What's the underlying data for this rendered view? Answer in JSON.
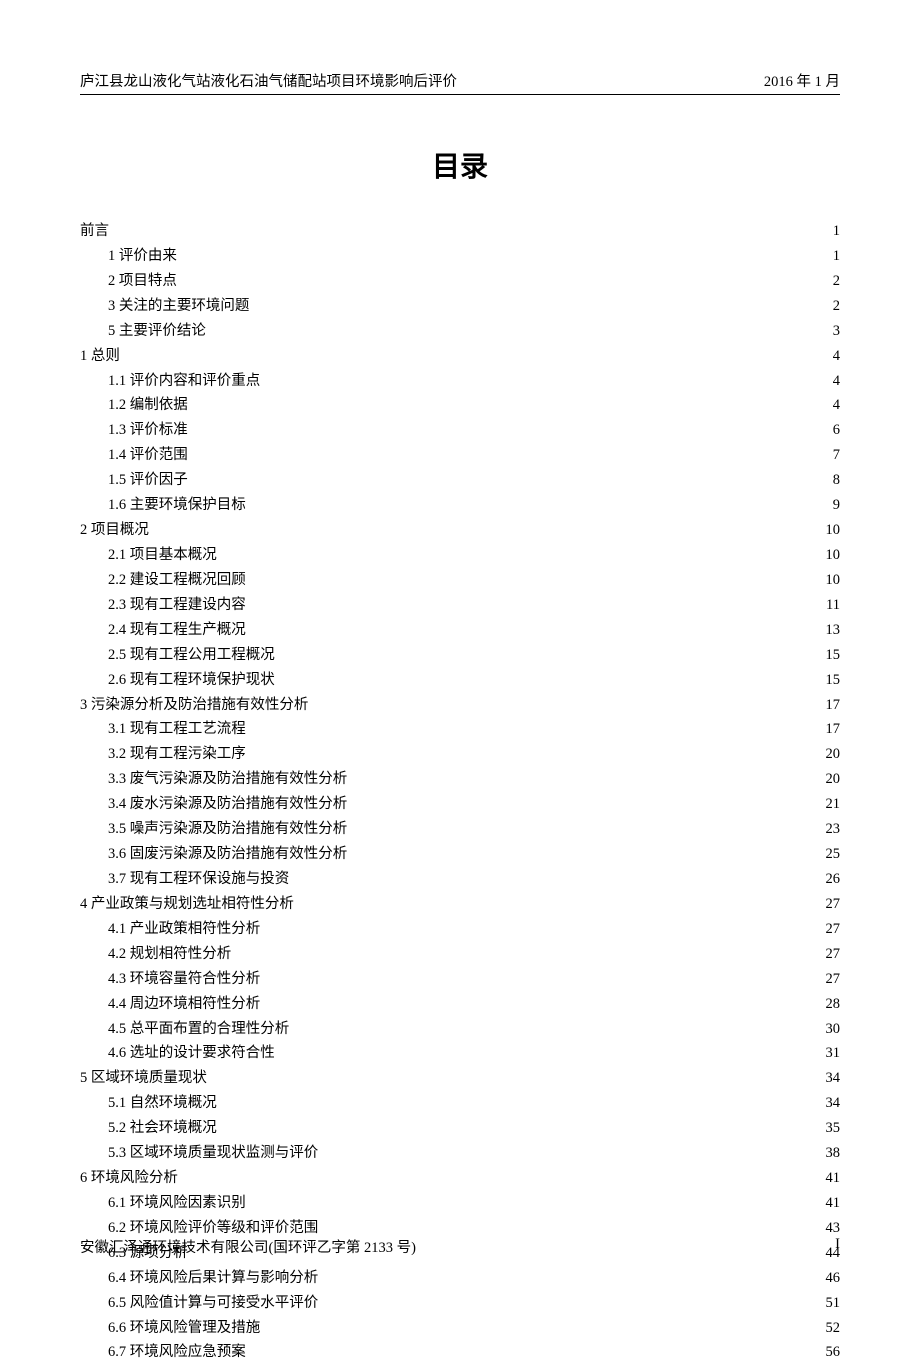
{
  "header": {
    "left": "庐江县龙山液化气站液化石油气储配站项目环境影响后评价",
    "right": "2016 年 1 月"
  },
  "title": "目录",
  "toc": [
    {
      "level": 0,
      "label": "前言",
      "page": "1"
    },
    {
      "level": 1,
      "label": "1 评价由来",
      "page": "1"
    },
    {
      "level": 1,
      "label": "2 项目特点",
      "page": "2"
    },
    {
      "level": 1,
      "label": "3 关注的主要环境问题",
      "page": "2"
    },
    {
      "level": 1,
      "label": "5 主要评价结论",
      "page": "3"
    },
    {
      "level": 0,
      "label": "1  总则",
      "page": "4"
    },
    {
      "level": 1,
      "label": "1.1 评价内容和评价重点",
      "page": "4"
    },
    {
      "level": 1,
      "label": "1.2 编制依据",
      "page": "4"
    },
    {
      "level": 1,
      "label": "1.3 评价标准",
      "page": "6"
    },
    {
      "level": 1,
      "label": "1.4 评价范围",
      "page": "7"
    },
    {
      "level": 1,
      "label": "1.5 评价因子",
      "page": "8"
    },
    {
      "level": 1,
      "label": "1.6 主要环境保护目标",
      "page": "9"
    },
    {
      "level": 0,
      "label": "2 项目概况",
      "page": "10"
    },
    {
      "level": 1,
      "label": "2.1 项目基本概况",
      "page": "10"
    },
    {
      "level": 1,
      "label": "2.2 建设工程概况回顾",
      "page": "10"
    },
    {
      "level": 1,
      "label": "2.3 现有工程建设内容",
      "page": "11"
    },
    {
      "level": 1,
      "label": "2.4 现有工程生产概况",
      "page": "13"
    },
    {
      "level": 1,
      "label": "2.5 现有工程公用工程概况",
      "page": "15"
    },
    {
      "level": 1,
      "label": "2.6 现有工程环境保护现状",
      "page": "15"
    },
    {
      "level": 0,
      "label": "3 污染源分析及防治措施有效性分析",
      "page": "17"
    },
    {
      "level": 1,
      "label": "3.1 现有工程工艺流程",
      "page": "17"
    },
    {
      "level": 1,
      "label": "3.2 现有工程污染工序",
      "page": "20"
    },
    {
      "level": 1,
      "label": "3.3 废气污染源及防治措施有效性分析",
      "page": "20"
    },
    {
      "level": 1,
      "label": "3.4 废水污染源及防治措施有效性分析",
      "page": "21"
    },
    {
      "level": 1,
      "label": "3.5 噪声污染源及防治措施有效性分析",
      "page": "23"
    },
    {
      "level": 1,
      "label": "3.6 固废污染源及防治措施有效性分析",
      "page": "25"
    },
    {
      "level": 1,
      "label": "3.7 现有工程环保设施与投资",
      "page": "26"
    },
    {
      "level": 0,
      "label": "4 产业政策与规划选址相符性分析",
      "page": "27"
    },
    {
      "level": 1,
      "label": "4.1 产业政策相符性分析",
      "page": "27"
    },
    {
      "level": 1,
      "label": "4.2 规划相符性分析",
      "page": "27"
    },
    {
      "level": 1,
      "label": "4.3 环境容量符合性分析",
      "page": "27"
    },
    {
      "level": 1,
      "label": "4.4 周边环境相符性分析",
      "page": "28"
    },
    {
      "level": 1,
      "label": "4.5 总平面布置的合理性分析",
      "page": "30"
    },
    {
      "level": 1,
      "label": "4.6 选址的设计要求符合性",
      "page": "31"
    },
    {
      "level": 0,
      "label": "5 区域环境质量现状",
      "page": "34"
    },
    {
      "level": 1,
      "label": "5.1 自然环境概况",
      "page": "34"
    },
    {
      "level": 1,
      "label": "5.2 社会环境概况",
      "page": "35"
    },
    {
      "level": 1,
      "label": "5.3 区域环境质量现状监测与评价",
      "page": "38"
    },
    {
      "level": 0,
      "label": "6 环境风险分析",
      "page": "41"
    },
    {
      "level": 1,
      "label": "6.1 环境风险因素识别",
      "page": "41"
    },
    {
      "level": 1,
      "label": "6.2 环境风险评价等级和评价范围",
      "page": "43"
    },
    {
      "level": 1,
      "label": "6.3 源项分析",
      "page": "44"
    },
    {
      "level": 1,
      "label": "6.4 环境风险后果计算与影响分析",
      "page": "46"
    },
    {
      "level": 1,
      "label": "6.5 风险值计算与可接受水平评价",
      "page": "51"
    },
    {
      "level": 1,
      "label": "6.6 环境风险管理及措施",
      "page": "52"
    },
    {
      "level": 1,
      "label": "6.7 环境风险应急预案",
      "page": "56"
    }
  ],
  "footer": {
    "left": "安徽汇泽通环境技术有限公司(国环评乙字第 2133 号)",
    "right": "I"
  }
}
